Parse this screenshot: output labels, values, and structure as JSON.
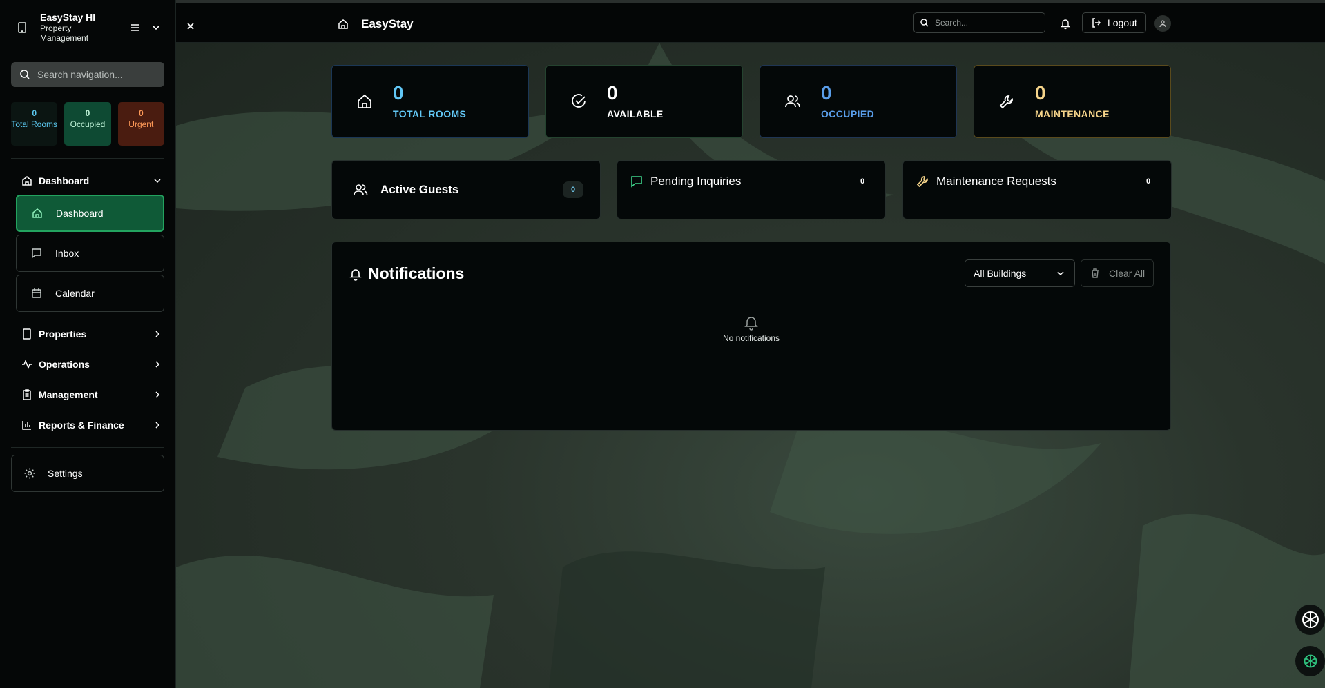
{
  "sidebar": {
    "brand_title": "EasyStay HI",
    "brand_subtitle": "Property Management",
    "search_placeholder": "Search navigation...",
    "stats": {
      "total_value": "0",
      "total_label": "Total Rooms",
      "occupied_value": "0",
      "occupied_label": "Occupied",
      "urgent_value": "0",
      "urgent_label": "Urgent"
    },
    "dashboard_group": "Dashboard",
    "items": [
      {
        "label": "Dashboard",
        "icon": "home-icon",
        "active": true
      },
      {
        "label": "Inbox",
        "icon": "message-icon"
      },
      {
        "label": "Calendar",
        "icon": "calendar-icon"
      }
    ],
    "groups": [
      {
        "label": "Properties",
        "icon": "building-icon"
      },
      {
        "label": "Operations",
        "icon": "activity-icon"
      },
      {
        "label": "Management",
        "icon": "clipboard-icon"
      },
      {
        "label": "Reports & Finance",
        "icon": "bar-chart-icon"
      }
    ],
    "settings_label": "Settings"
  },
  "topbar": {
    "title": "EasyStay",
    "search_placeholder": "Search...",
    "logout_label": "Logout"
  },
  "stats_cards": [
    {
      "value": "0",
      "label": "TOTAL ROOMS",
      "icon": "home-icon",
      "color": "#62c7f5"
    },
    {
      "value": "0",
      "label": "AVAILABLE",
      "icon": "check-circle-icon",
      "color": "#ffffff"
    },
    {
      "value": "0",
      "label": "OCCUPIED",
      "icon": "users-icon",
      "color": "#5a9eea"
    },
    {
      "value": "0",
      "label": "MAINTENANCE",
      "icon": "wrench-icon",
      "color": "#f5d48a"
    }
  ],
  "summary_cards": [
    {
      "label": "Active Guests",
      "count": "0",
      "icon": "users-icon"
    },
    {
      "label": "Pending Inquiries",
      "count": "0",
      "icon": "message-icon"
    },
    {
      "label": "Maintenance Requests",
      "count": "0",
      "icon": "wrench-icon"
    }
  ],
  "notifications": {
    "title": "Notifications",
    "filter_value": "All Buildings",
    "clear_label": "Clear All",
    "empty_text": "No notifications"
  },
  "colors": {
    "accent_green": "#23a35f",
    "total_blue": "#62c7f5",
    "occupied_blue": "#5a9eea",
    "maintenance_yellow": "#f5d48a",
    "urgent_orange": "#ff9a58"
  }
}
